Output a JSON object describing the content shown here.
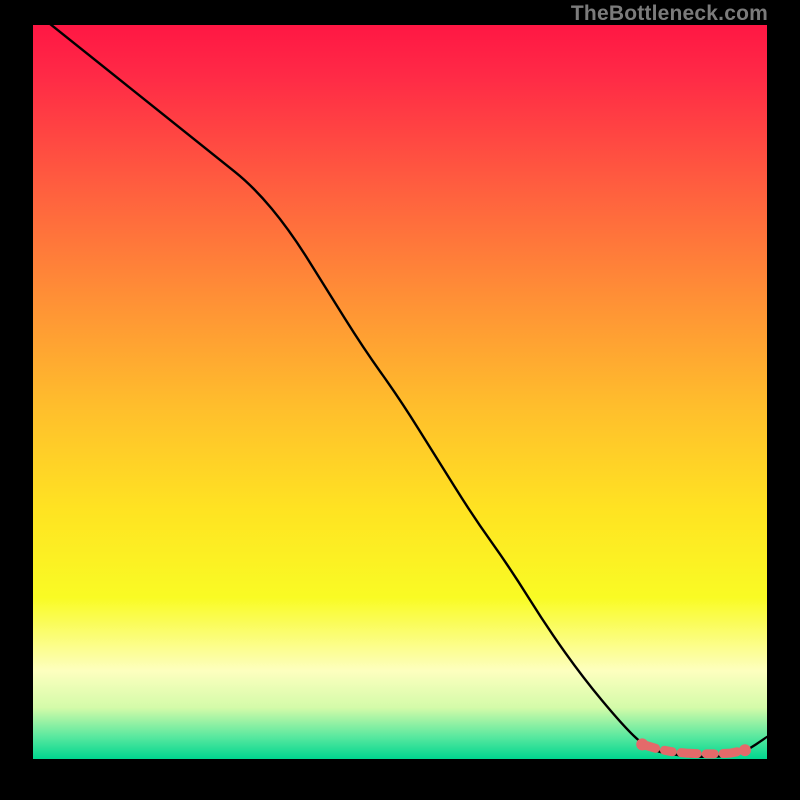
{
  "watermark": "TheBottleneck.com",
  "chart_data": {
    "type": "line",
    "title": "",
    "xlabel": "",
    "ylabel": "",
    "xlim": [
      0,
      100
    ],
    "ylim": [
      0,
      100
    ],
    "grid": false,
    "legend": false,
    "background": {
      "type": "vertical-gradient",
      "stops": [
        {
          "pos": 0.0,
          "color": "#ff1744"
        },
        {
          "pos": 0.07,
          "color": "#ff2a46"
        },
        {
          "pos": 0.22,
          "color": "#ff5e3f"
        },
        {
          "pos": 0.37,
          "color": "#ff8f36"
        },
        {
          "pos": 0.52,
          "color": "#ffbe2c"
        },
        {
          "pos": 0.66,
          "color": "#ffe322"
        },
        {
          "pos": 0.78,
          "color": "#f9fb24"
        },
        {
          "pos": 0.88,
          "color": "#fdffbf"
        },
        {
          "pos": 0.93,
          "color": "#d4fba9"
        },
        {
          "pos": 0.97,
          "color": "#58e89f"
        },
        {
          "pos": 1.0,
          "color": "#00d68f"
        }
      ]
    },
    "series": [
      {
        "name": "bottleneck-curve",
        "color": "#000000",
        "width": 2,
        "x": [
          0,
          5,
          10,
          15,
          20,
          25,
          30,
          35,
          40,
          45,
          50,
          55,
          60,
          65,
          70,
          75,
          80,
          83,
          85,
          88,
          90,
          93,
          95,
          97,
          100
        ],
        "y": [
          102,
          98,
          94,
          90,
          86,
          82,
          78,
          72,
          64,
          56,
          49,
          41,
          33,
          26,
          18,
          11,
          5,
          2,
          1,
          0.5,
          0.3,
          0.3,
          0.5,
          1,
          3
        ]
      }
    ],
    "markers": [
      {
        "name": "range-marker",
        "color": "#e46a6a",
        "style": "dashed-rounded",
        "x": [
          83,
          85,
          87,
          89,
          91,
          93,
          95,
          97
        ],
        "y": [
          2,
          1.4,
          1.0,
          0.8,
          0.7,
          0.7,
          0.8,
          1.2
        ],
        "endpoint_radius": 6
      }
    ]
  }
}
